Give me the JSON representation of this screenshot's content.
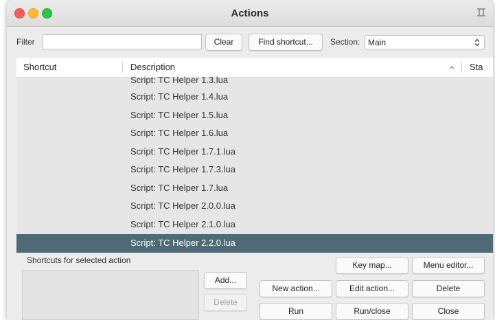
{
  "window": {
    "title": "Actions"
  },
  "filter": {
    "label": "Filter",
    "value": "",
    "clear_label": "Clear",
    "find_shortcut_label": "Find shortcut...",
    "section_label": "Section:",
    "section_value": "Main"
  },
  "table": {
    "columns": [
      "Shortcut",
      "Description",
      "Sta"
    ],
    "rows": [
      "Script: TC Helper 1.3.lua",
      "Script: TC Helper 1.4.lua",
      "Script: TC Helper 1.5.lua",
      "Script: TC Helper 1.6.lua",
      "Script: TC Helper 1.7.1.lua",
      "Script: TC Helper 1.7.3.lua",
      "Script: TC Helper 1.7.lua",
      "Script: TC Helper 2.0.0.lua",
      "Script: TC Helper 2.1.0.lua",
      "Script: TC Helper 2.2.0.lua"
    ],
    "selected_row": "Script: TC Helper 2.2.0.lua"
  },
  "shortcuts": {
    "label": "Shortcuts for selected action",
    "add_label": "Add...",
    "delete_label": "Delete"
  },
  "buttons": {
    "key_map": "Key map...",
    "menu_editor": "Menu editor...",
    "new_action": "New action...",
    "edit_action": "Edit action...",
    "delete": "Delete",
    "run": "Run",
    "run_close": "Run/close",
    "close": "Close"
  },
  "colors": {
    "selection": "#4e6b75",
    "close_red": "#fe5f57",
    "minimize_yellow": "#febc2e",
    "zoom_green": "#28c840"
  }
}
